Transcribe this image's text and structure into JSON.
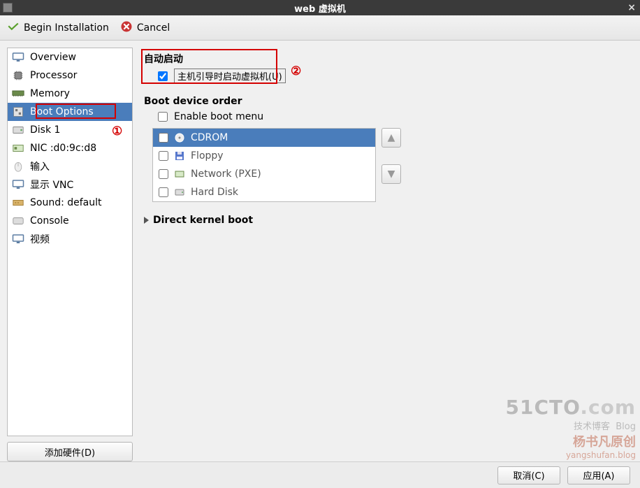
{
  "window": {
    "title": "web 虚拟机"
  },
  "toolbar": {
    "begin_label": "Begin Installation",
    "cancel_label": "Cancel"
  },
  "sidebar": {
    "items": [
      {
        "label": "Overview",
        "icon": "monitor-icon"
      },
      {
        "label": "Processor",
        "icon": "cpu-icon"
      },
      {
        "label": "Memory",
        "icon": "ram-icon"
      },
      {
        "label": "Boot Options",
        "icon": "boot-icon",
        "selected": true
      },
      {
        "label": "Disk 1",
        "icon": "disk-icon"
      },
      {
        "label": "NIC :d0:9c:d8",
        "icon": "nic-icon"
      },
      {
        "label": "输入",
        "icon": "mouse-icon"
      },
      {
        "label": "显示 VNC",
        "icon": "monitor-icon"
      },
      {
        "label": "Sound: default",
        "icon": "sound-icon"
      },
      {
        "label": "Console",
        "icon": "console-icon"
      },
      {
        "label": "视频",
        "icon": "monitor-icon"
      }
    ],
    "add_hw_label": "添加硬件(D)"
  },
  "content": {
    "autostart": {
      "title": "自动启动",
      "checkbox_label": "主机引导时启动虚拟机(U)",
      "checked": true
    },
    "boot_order": {
      "title": "Boot device order",
      "enable_menu_label": "Enable boot menu",
      "enable_menu_checked": false,
      "devices": [
        {
          "label": "CDROM",
          "checked": false,
          "icon": "cdrom-icon",
          "selected": true
        },
        {
          "label": "Floppy",
          "checked": false,
          "icon": "floppy-icon",
          "selected": false
        },
        {
          "label": "Network (PXE)",
          "checked": false,
          "icon": "nic-icon",
          "selected": false
        },
        {
          "label": "Hard Disk",
          "checked": false,
          "icon": "hdd-icon",
          "selected": false
        }
      ]
    },
    "direct_kernel_boot_label": "Direct kernel boot"
  },
  "footer": {
    "cancel_label": "取消(C)",
    "apply_label": "应用(A)"
  },
  "annotations": {
    "num1": "①",
    "num2": "②"
  },
  "watermark": {
    "line1a": "51CTO",
    "line1b": ".com",
    "line2a": "技术博客",
    "line2b": "Blog",
    "line3": "杨书凡原创",
    "line4": "yangshufan.blog"
  }
}
